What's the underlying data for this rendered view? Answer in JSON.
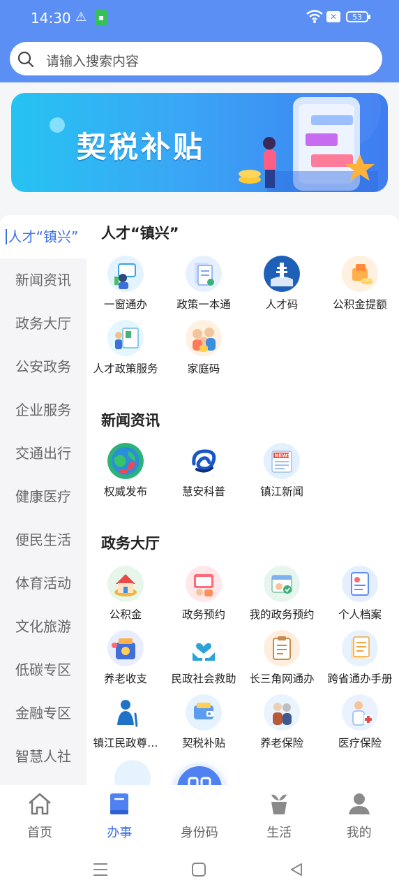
{
  "status_bar": {
    "time": "14:30",
    "battery": "53"
  },
  "search": {
    "placeholder": "请输入搜索内容"
  },
  "banner": {
    "title": "契税补贴"
  },
  "sidebar": {
    "items": [
      "人才“镇兴”",
      "新闻资讯",
      "政务大厅",
      "公安政务",
      "企业服务",
      "交通出行",
      "健康医疗",
      "便民生活",
      "体育活动",
      "文化旅游",
      "低碳专区",
      "金融专区",
      "智慧人社"
    ],
    "active_index": 0
  },
  "sections": [
    {
      "title": "人才“镇兴”",
      "items": [
        {
          "label": "一窗通办",
          "icon": "service-window-icon"
        },
        {
          "label": "政策一本通",
          "icon": "policy-book-icon"
        },
        {
          "label": "人才码",
          "icon": "talent-code-icon"
        },
        {
          "label": "公积金提额",
          "icon": "fund-increase-icon"
        },
        {
          "label": "人才政策服务",
          "icon": "talent-policy-icon"
        },
        {
          "label": "家庭码",
          "icon": "family-code-icon"
        }
      ]
    },
    {
      "title": "新闻资讯",
      "items": [
        {
          "label": "权威发布",
          "icon": "globe-microphone-icon"
        },
        {
          "label": "慧安科普",
          "icon": "knot-logo-icon"
        },
        {
          "label": "镇江新闻",
          "icon": "newspaper-icon"
        }
      ]
    },
    {
      "title": "政务大厅",
      "items": [
        {
          "label": "公积金",
          "icon": "house-fund-icon"
        },
        {
          "label": "政务预约",
          "icon": "appointment-icon"
        },
        {
          "label": "我的政务预约",
          "icon": "my-appointment-icon"
        },
        {
          "label": "个人档案",
          "icon": "personal-file-icon"
        },
        {
          "label": "养老收支",
          "icon": "pension-wallet-icon"
        },
        {
          "label": "民政社会救助",
          "icon": "heart-hands-icon"
        },
        {
          "label": "长三角网通办",
          "icon": "clipboard-icon"
        },
        {
          "label": "跨省通办手册",
          "icon": "manual-icon"
        },
        {
          "label": "镇江民政尊…",
          "icon": "elderly-person-icon"
        },
        {
          "label": "契税补贴",
          "icon": "deed-tax-icon"
        },
        {
          "label": "养老保险",
          "icon": "pension-insurance-icon"
        },
        {
          "label": "医疗保险",
          "icon": "medical-insurance-icon"
        }
      ]
    }
  ],
  "tabbar": {
    "tabs": [
      {
        "label": "首页",
        "icon": "home-icon"
      },
      {
        "label": "办事",
        "icon": "book-icon"
      },
      {
        "label": "身份码",
        "icon": "qr-code-icon"
      },
      {
        "label": "生活",
        "icon": "plant-pot-icon"
      },
      {
        "label": "我的",
        "icon": "person-icon"
      }
    ],
    "active_index": 1
  },
  "colors": {
    "accent": "#3b6fe8",
    "header": "#5b8ff4",
    "fab": "#4f82f0"
  }
}
